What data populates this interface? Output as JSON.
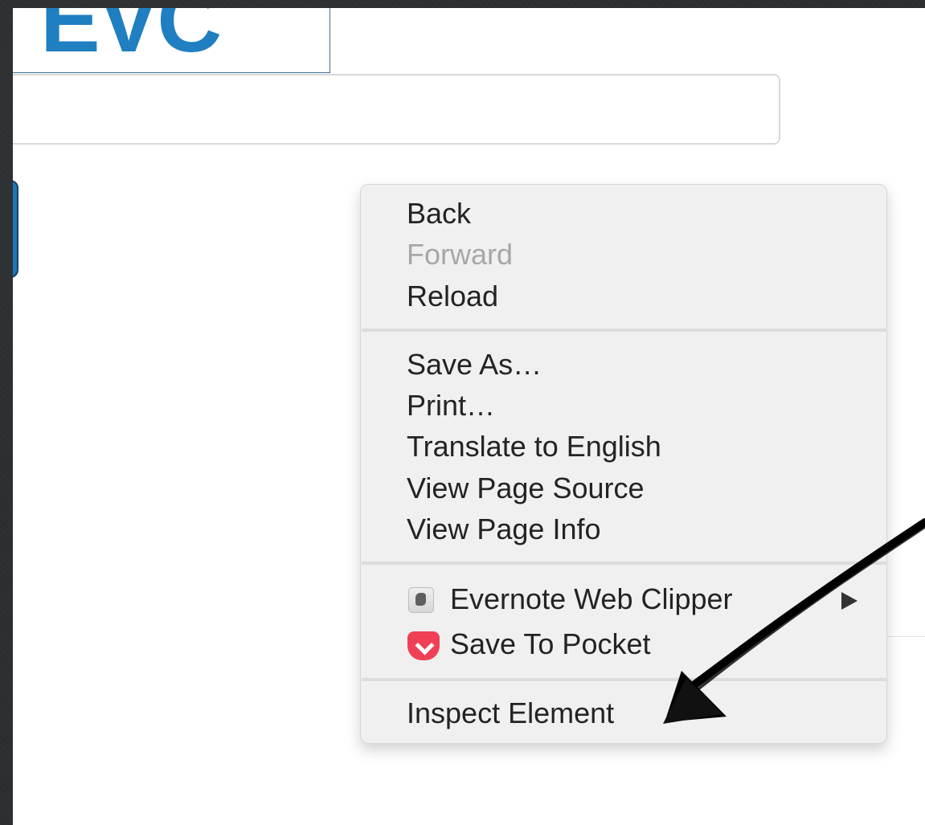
{
  "logo": {
    "text": "EVC"
  },
  "search": {
    "value": "",
    "placeholder": ""
  },
  "context_menu": {
    "items": [
      {
        "label": "Back",
        "enabled": true
      },
      {
        "label": "Forward",
        "enabled": false
      },
      {
        "label": "Reload",
        "enabled": true
      },
      {
        "label": "Save As…",
        "enabled": true
      },
      {
        "label": "Print…",
        "enabled": true
      },
      {
        "label": "Translate to English",
        "enabled": true
      },
      {
        "label": "View Page Source",
        "enabled": true
      },
      {
        "label": "View Page Info",
        "enabled": true
      },
      {
        "label": "Evernote Web Clipper",
        "enabled": true,
        "icon": "evernote-icon",
        "submenu": true
      },
      {
        "label": "Save To Pocket",
        "enabled": true,
        "icon": "pocket-icon"
      },
      {
        "label": "Inspect Element",
        "enabled": true
      }
    ]
  },
  "annotation": {
    "type": "hand-drawn-arrow",
    "color": "#000000"
  },
  "colors": {
    "page_background": "#ffffff",
    "outer_background": "#2b2d30",
    "logo_blue": "#1f7fc1",
    "menu_background": "#f0f0f0",
    "disabled_text": "#a7a7a7"
  }
}
